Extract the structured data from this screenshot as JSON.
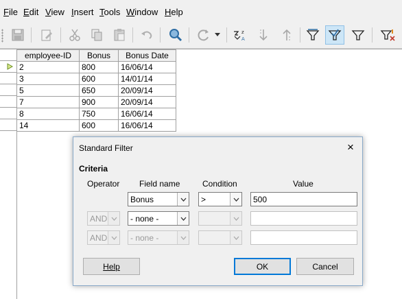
{
  "menu": {
    "items": [
      {
        "pre": "",
        "ul": "F",
        "post": "ile"
      },
      {
        "pre": "",
        "ul": "E",
        "post": "dit"
      },
      {
        "pre": "",
        "ul": "V",
        "post": "iew"
      },
      {
        "pre": "",
        "ul": "I",
        "post": "nsert"
      },
      {
        "pre": "",
        "ul": "T",
        "post": "ools"
      },
      {
        "pre": "",
        "ul": "W",
        "post": "indow"
      },
      {
        "pre": "",
        "ul": "H",
        "post": "elp"
      }
    ]
  },
  "toolbar": {
    "icons": [
      "save-icon",
      "edit-icon",
      "cut-icon",
      "copy-icon",
      "paste-icon",
      "undo-icon",
      "find-icon",
      "refresh-icon",
      "sort-icon",
      "sort-ascending-icon",
      "sort-descending-icon",
      "autofilter-icon",
      "standard-filter-icon",
      "apply-filter-icon",
      "reset-filter-icon"
    ]
  },
  "table": {
    "headers": [
      "employee-ID",
      "Bonus",
      "Bonus Date"
    ],
    "rows": [
      [
        "2",
        "800",
        "16/06/14"
      ],
      [
        "3",
        "600",
        "14/01/14"
      ],
      [
        "5",
        "650",
        "20/09/14"
      ],
      [
        "7",
        "900",
        "20/09/14"
      ],
      [
        "8",
        "750",
        "16/06/14"
      ],
      [
        "14",
        "600",
        "16/06/14"
      ]
    ]
  },
  "dialog": {
    "title": "Standard Filter",
    "close_label": "×",
    "criteria_label": "Criteria",
    "col_operator": "Operator",
    "col_field_name": "Field name",
    "col_condition": "Condition",
    "col_value": "Value",
    "rows": [
      {
        "operator": "",
        "field": "Bonus",
        "condition": ">",
        "value": "500"
      },
      {
        "operator": "AND",
        "field": "- none -",
        "condition": "",
        "value": ""
      },
      {
        "operator": "AND",
        "field": "- none -",
        "condition": "",
        "value": ""
      }
    ],
    "help_label": "Help",
    "ok_label": "OK",
    "cancel_label": "Cancel"
  }
}
